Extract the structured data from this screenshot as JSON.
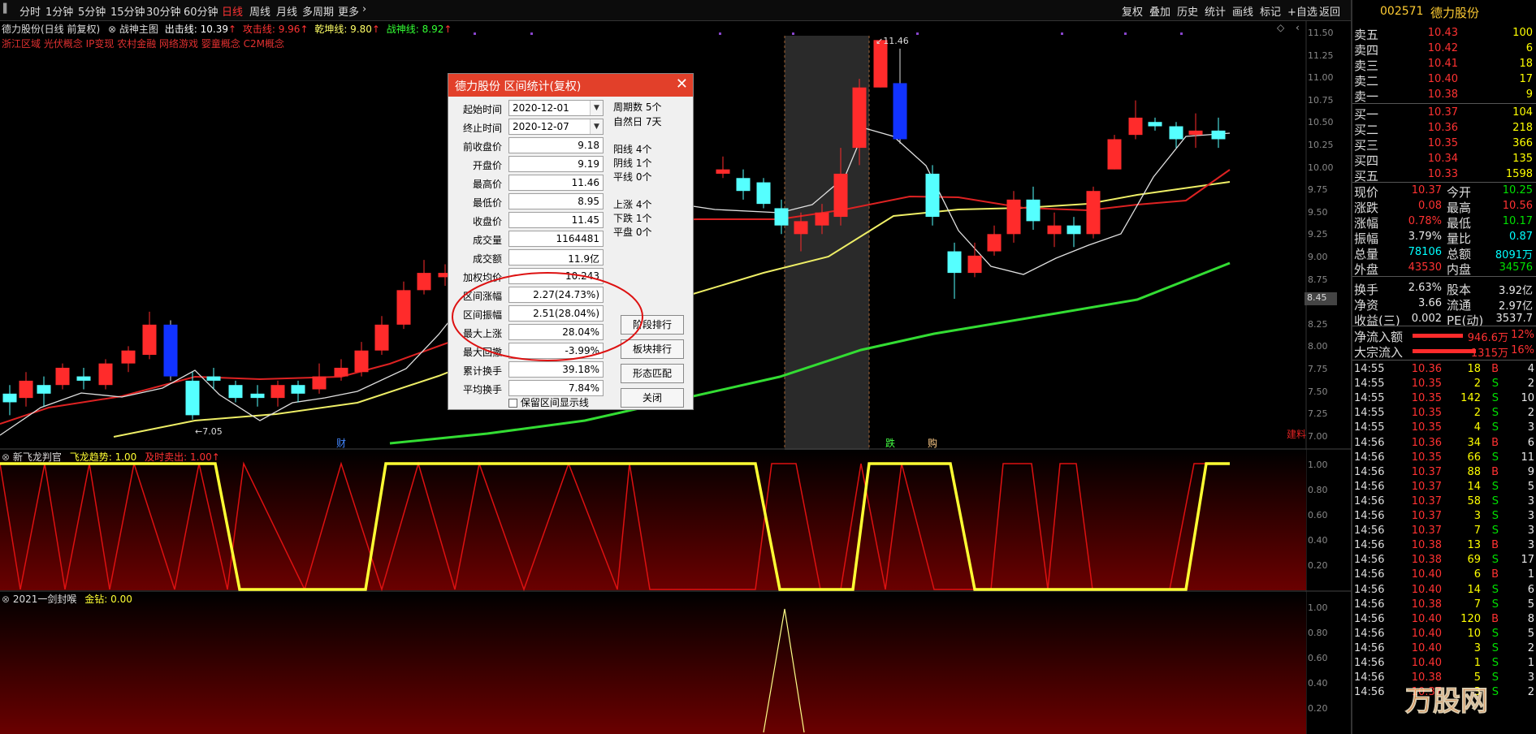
{
  "toolbar": {
    "periods": [
      "分时",
      "1分钟",
      "5分钟",
      "15分钟",
      "30分钟",
      "60分钟",
      "日线",
      "周线",
      "月线",
      "多周期",
      "更多"
    ],
    "active_period": "日线",
    "right": [
      "复权",
      "叠加",
      "历史",
      "统计",
      "画线",
      "标记",
      "+自选",
      "返回"
    ]
  },
  "chart_header": {
    "title": "德力股份(日线 前复权)",
    "indicator": "战神主图",
    "line1_label": "出击线: 10.39",
    "line2_label": "攻击线: 9.96",
    "line3_label": "乾坤线: 9.80",
    "line4_label": "战神线: 8.92",
    "concepts": "浙江区域 光伏概念 IP变现 农村金融 网络游戏 婴童概念 C2M概念"
  },
  "price_axis": [
    "11.50",
    "11.25",
    "11.00",
    "10.75",
    "10.50",
    "10.25",
    "10.00",
    "9.75",
    "9.50",
    "9.25",
    "9.00",
    "8.75",
    "8.50",
    "8.25",
    "8.00",
    "7.75",
    "7.50",
    "7.25",
    "7.00"
  ],
  "price_marker": "8.45",
  "annotations": {
    "high": "11.46",
    "low": "7.05",
    "cai": "财",
    "die": "跌",
    "gou": "购",
    "jian": "建料"
  },
  "panel2": {
    "name": "新飞龙判官",
    "trend": "飞龙趋势: 1.00",
    "sell": "及时卖出: 1.00",
    "axis": [
      "1.00",
      "0.80",
      "0.60",
      "0.40",
      "0.20"
    ]
  },
  "panel3": {
    "name": "2021一剑封喉",
    "gold": "金钻: 0.00",
    "axis": [
      "1.00",
      "0.80",
      "0.60",
      "0.40",
      "0.20"
    ]
  },
  "dialog": {
    "title": "德力股份  区间统计(复权)",
    "close": "✕",
    "fields": [
      {
        "label": "起始时间",
        "value": "2020-12-01",
        "type": "date"
      },
      {
        "label": "终止时间",
        "value": "2020-12-07",
        "type": "date"
      },
      {
        "label": "前收盘价",
        "value": "9.18"
      },
      {
        "label": "开盘价",
        "value": "9.19"
      },
      {
        "label": "最高价",
        "value": "11.46"
      },
      {
        "label": "最低价",
        "value": "8.95"
      },
      {
        "label": "收盘价",
        "value": "11.45"
      },
      {
        "label": "成交量",
        "value": "1164481"
      },
      {
        "label": "成交额",
        "value": "11.9亿"
      },
      {
        "label": "加权均价",
        "value": "10.243"
      },
      {
        "label": "区间涨幅",
        "value": "2.27(24.73%)"
      },
      {
        "label": "区间振幅",
        "value": "2.51(28.04%)"
      },
      {
        "label": "最大上涨",
        "value": "28.04%"
      },
      {
        "label": "最大回撤",
        "value": "-3.99%"
      },
      {
        "label": "累计换手",
        "value": "39.18%"
      },
      {
        "label": "平均换手",
        "value": "7.84%"
      }
    ],
    "info": [
      "周期数 5个",
      "自然日 7天",
      "阳线 4个",
      "阴线 1个",
      "平线 0个",
      "上涨 4个",
      "下跌 1个",
      "平盘 0个"
    ],
    "buttons": [
      "阶段排行",
      "板块排行",
      "形态匹配",
      "关闭"
    ],
    "checkbox": "保留区间显示线"
  },
  "quote": {
    "code": "002571",
    "name": "德力股份",
    "asks": [
      {
        "l": "卖五",
        "p": "10.43",
        "v": "100"
      },
      {
        "l": "卖四",
        "p": "10.42",
        "v": "6"
      },
      {
        "l": "卖三",
        "p": "10.41",
        "v": "18"
      },
      {
        "l": "卖二",
        "p": "10.40",
        "v": "17"
      },
      {
        "l": "卖一",
        "p": "10.38",
        "v": "9"
      }
    ],
    "bids": [
      {
        "l": "买一",
        "p": "10.37",
        "v": "104"
      },
      {
        "l": "买二",
        "p": "10.36",
        "v": "218"
      },
      {
        "l": "买三",
        "p": "10.35",
        "v": "366"
      },
      {
        "l": "买四",
        "p": "10.34",
        "v": "135"
      },
      {
        "l": "买五",
        "p": "10.33",
        "v": "1598"
      }
    ],
    "stats": [
      {
        "l1": "现价",
        "v1": "10.37",
        "c1": "red",
        "l2": "今开",
        "v2": "10.25",
        "c2": "green"
      },
      {
        "l1": "涨跌",
        "v1": "0.08",
        "c1": "red",
        "l2": "最高",
        "v2": "10.56",
        "c2": "red"
      },
      {
        "l1": "涨幅",
        "v1": "0.78%",
        "c1": "red",
        "l2": "最低",
        "v2": "10.17",
        "c2": "green"
      },
      {
        "l1": "振幅",
        "v1": "3.79%",
        "c1": "white",
        "l2": "量比",
        "v2": "0.87",
        "c2": "cyan"
      },
      {
        "l1": "总量",
        "v1": "78106",
        "c1": "cyan",
        "l2": "总额",
        "v2": "8091万",
        "c2": "cyan"
      },
      {
        "l1": "外盘",
        "v1": "43530",
        "c1": "red",
        "l2": "内盘",
        "v2": "34576",
        "c2": "green"
      },
      {
        "l1": "换手",
        "v1": "2.63%",
        "c1": "white",
        "l2": "股本",
        "v2": "3.92亿",
        "c2": "white"
      },
      {
        "l1": "净资",
        "v1": "3.66",
        "c1": "white",
        "l2": "流通",
        "v2": "2.97亿",
        "c2": "white"
      },
      {
        "l1": "收益(三)",
        "v1": "0.002",
        "c1": "white",
        "l2": "PE(动)",
        "v2": "3537.7",
        "c2": "white"
      }
    ],
    "flows": [
      {
        "l": "净流入额",
        "v": "946.6万",
        "p": "12%"
      },
      {
        "l": "大宗流入",
        "v": "1315万",
        "p": "16%"
      }
    ],
    "ticks": [
      {
        "t": "14:55",
        "p": "10.36",
        "v": "18",
        "s": "B",
        "n": "4"
      },
      {
        "t": "14:55",
        "p": "10.35",
        "v": "2",
        "s": "S",
        "n": "2"
      },
      {
        "t": "14:55",
        "p": "10.35",
        "v": "142",
        "s": "S",
        "n": "10"
      },
      {
        "t": "14:55",
        "p": "10.35",
        "v": "2",
        "s": "S",
        "n": "2"
      },
      {
        "t": "14:55",
        "p": "10.35",
        "v": "4",
        "s": "S",
        "n": "3"
      },
      {
        "t": "14:56",
        "p": "10.36",
        "v": "34",
        "s": "B",
        "n": "6"
      },
      {
        "t": "14:56",
        "p": "10.35",
        "v": "66",
        "s": "S",
        "n": "11"
      },
      {
        "t": "14:56",
        "p": "10.37",
        "v": "88",
        "s": "B",
        "n": "9"
      },
      {
        "t": "14:56",
        "p": "10.37",
        "v": "14",
        "s": "S",
        "n": "5"
      },
      {
        "t": "14:56",
        "p": "10.37",
        "v": "58",
        "s": "S",
        "n": "3"
      },
      {
        "t": "14:56",
        "p": "10.37",
        "v": "3",
        "s": "S",
        "n": "3"
      },
      {
        "t": "14:56",
        "p": "10.37",
        "v": "7",
        "s": "S",
        "n": "3"
      },
      {
        "t": "14:56",
        "p": "10.38",
        "v": "13",
        "s": "B",
        "n": "3"
      },
      {
        "t": "14:56",
        "p": "10.38",
        "v": "69",
        "s": "S",
        "n": "17"
      },
      {
        "t": "14:56",
        "p": "10.40",
        "v": "6",
        "s": "B",
        "n": "1"
      },
      {
        "t": "14:56",
        "p": "10.40",
        "v": "14",
        "s": "S",
        "n": "6"
      },
      {
        "t": "14:56",
        "p": "10.38",
        "v": "7",
        "s": "S",
        "n": "5"
      },
      {
        "t": "14:56",
        "p": "10.40",
        "v": "120",
        "s": "B",
        "n": "8"
      },
      {
        "t": "14:56",
        "p": "10.40",
        "v": "10",
        "s": "S",
        "n": "5"
      },
      {
        "t": "14:56",
        "p": "10.40",
        "v": "3",
        "s": "S",
        "n": "2"
      },
      {
        "t": "14:56",
        "p": "10.40",
        "v": "1",
        "s": "S",
        "n": "1"
      },
      {
        "t": "14:56",
        "p": "10.38",
        "v": "5",
        "s": "S",
        "n": "3"
      },
      {
        "t": "14:56",
        "p": "10.37",
        "v": "3",
        "s": "S",
        "n": "2"
      }
    ]
  },
  "watermark": "万股网",
  "candles": [
    {
      "o": 7.35,
      "c": 7.25,
      "h": 7.45,
      "l": 7.1
    },
    {
      "o": 7.3,
      "c": 7.5,
      "h": 7.6,
      "l": 7.2
    },
    {
      "o": 7.45,
      "c": 7.35,
      "h": 7.55,
      "l": 7.2
    },
    {
      "o": 7.45,
      "c": 7.65,
      "h": 7.7,
      "l": 7.4
    },
    {
      "o": 7.55,
      "c": 7.5,
      "h": 7.65,
      "l": 7.4
    },
    {
      "o": 7.45,
      "c": 7.7,
      "h": 7.75,
      "l": 7.4
    },
    {
      "o": 7.7,
      "c": 7.85,
      "h": 7.9,
      "l": 7.6
    },
    {
      "o": 7.8,
      "c": 8.15,
      "h": 8.3,
      "l": 7.75
    },
    {
      "o": 8.15,
      "c": 7.55,
      "h": 8.2,
      "l": 7.5
    },
    {
      "o": 7.5,
      "c": 7.1,
      "h": 7.6,
      "l": 7.05
    },
    {
      "o": 7.55,
      "c": 7.5,
      "h": 7.65,
      "l": 7.4
    },
    {
      "o": 7.45,
      "c": 7.3,
      "h": 7.5,
      "l": 7.25
    },
    {
      "o": 7.35,
      "c": 7.3,
      "h": 7.45,
      "l": 7.2
    },
    {
      "o": 7.3,
      "c": 7.45,
      "h": 7.5,
      "l": 7.2
    },
    {
      "o": 7.45,
      "c": 7.35,
      "h": 7.5,
      "l": 7.25
    },
    {
      "o": 7.4,
      "c": 7.55,
      "h": 7.7,
      "l": 7.35
    },
    {
      "o": 7.55,
      "c": 7.65,
      "h": 7.75,
      "l": 7.5
    },
    {
      "o": 7.6,
      "c": 7.85,
      "h": 7.95,
      "l": 7.55
    },
    {
      "o": 7.85,
      "c": 8.15,
      "h": 8.25,
      "l": 7.8
    },
    {
      "o": 8.15,
      "c": 8.55,
      "h": 8.65,
      "l": 8.1
    },
    {
      "o": 8.55,
      "c": 8.75,
      "h": 8.9,
      "l": 8.5
    },
    {
      "o": 8.7,
      "c": 8.75,
      "h": 8.85,
      "l": 8.6
    },
    {
      "o": 8.75,
      "c": 8.85,
      "h": 8.95,
      "l": 8.7
    },
    {
      "o": 9.9,
      "c": 9.95,
      "h": 10.1,
      "l": 9.85
    },
    {
      "o": 9.85,
      "c": 9.7,
      "h": 9.95,
      "l": 9.6
    },
    {
      "o": 9.8,
      "c": 9.55,
      "h": 9.85,
      "l": 9.5
    },
    {
      "o": 9.5,
      "c": 9.3,
      "h": 9.6,
      "l": 9.2
    },
    {
      "o": 9.2,
      "c": 9.35,
      "h": 9.45,
      "l": 9.0
    },
    {
      "o": 9.3,
      "c": 9.45,
      "h": 9.55,
      "l": 9.2
    },
    {
      "o": 9.4,
      "c": 9.9,
      "h": 10.2,
      "l": 9.3
    },
    {
      "o": 10.2,
      "c": 10.9,
      "h": 11.0,
      "l": 10.0
    },
    {
      "o": 10.9,
      "c": 11.45,
      "h": 11.46,
      "l": 10.9
    },
    {
      "o": 10.95,
      "c": 10.3,
      "h": 11.35,
      "l": 10.25
    },
    {
      "o": 9.9,
      "c": 9.4,
      "h": 10.0,
      "l": 9.3
    },
    {
      "o": 9.0,
      "c": 8.75,
      "h": 9.1,
      "l": 8.45
    },
    {
      "o": 8.75,
      "c": 8.95,
      "h": 9.1,
      "l": 8.7
    },
    {
      "o": 9.0,
      "c": 9.2,
      "h": 9.3,
      "l": 8.95
    },
    {
      "o": 9.2,
      "c": 9.6,
      "h": 9.7,
      "l": 9.1
    },
    {
      "o": 9.6,
      "c": 9.35,
      "h": 9.75,
      "l": 9.25
    },
    {
      "o": 9.2,
      "c": 9.3,
      "h": 9.45,
      "l": 9.05
    },
    {
      "o": 9.3,
      "c": 9.2,
      "h": 9.4,
      "l": 9.05
    },
    {
      "o": 9.2,
      "c": 9.7,
      "h": 9.75,
      "l": 9.15
    },
    {
      "o": 9.95,
      "c": 10.3,
      "h": 10.35,
      "l": 9.95
    },
    {
      "o": 10.35,
      "c": 10.55,
      "h": 10.75,
      "l": 10.3
    },
    {
      "o": 10.5,
      "c": 10.45,
      "h": 10.55,
      "l": 10.4
    },
    {
      "o": 10.45,
      "c": 10.3,
      "h": 10.5,
      "l": 10.2
    },
    {
      "o": 10.35,
      "c": 10.4,
      "h": 10.6,
      "l": 10.2
    },
    {
      "o": 10.4,
      "c": 10.3,
      "h": 10.55,
      "l": 10.2
    }
  ]
}
